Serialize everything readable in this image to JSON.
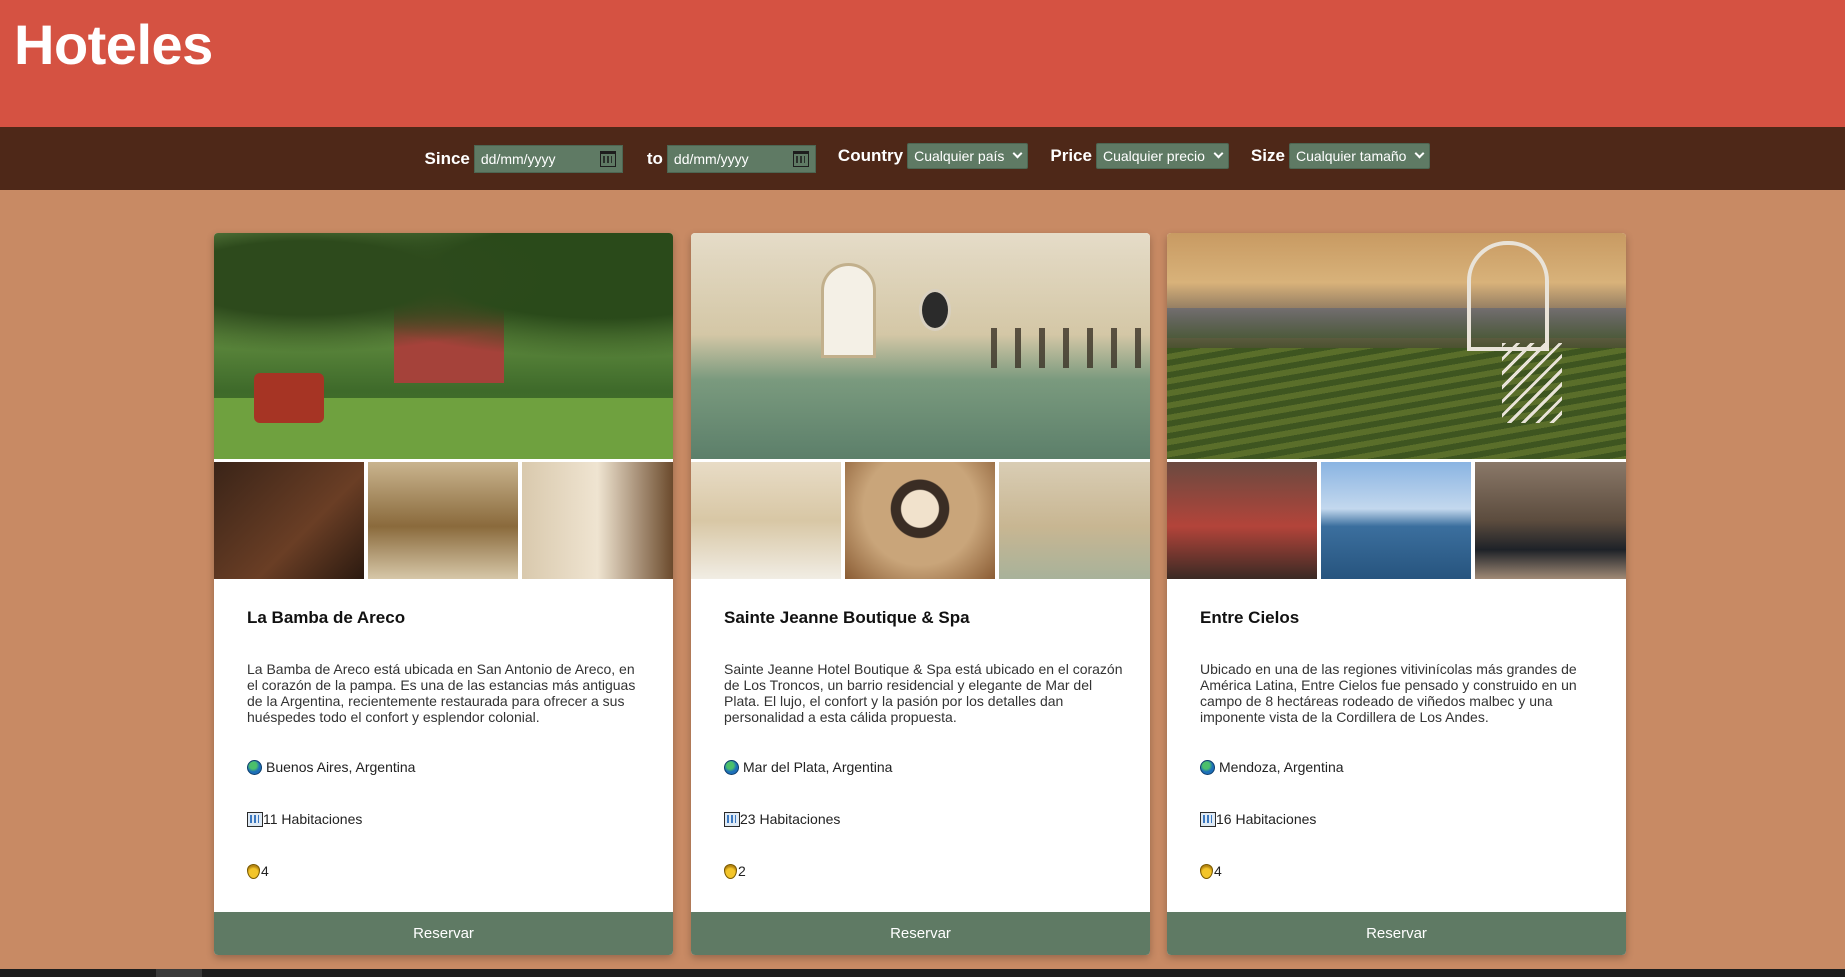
{
  "header": {
    "title": "Hoteles"
  },
  "filters": {
    "since_label": "Since",
    "since_placeholder": "dd/mm/yyyy",
    "to_label": "to",
    "to_placeholder": "dd/mm/yyyy",
    "country_label": "Country",
    "country_value": "Cualquier país",
    "price_label": "Price",
    "price_value": "Cualquier precio",
    "size_label": "Size",
    "size_value": "Cualquier tamaño"
  },
  "hotels": [
    {
      "name": "La Bamba de Areco",
      "description": "La Bamba de Areco está ubicada en San Antonio de Areco, en el corazón de la pampa. Es una de las estancias más antiguas de la Argentina, recientemente restaurada para ofrecer a sus huéspedes todo el confort y esplendor colonial.",
      "location": "Buenos Aires, Argentina",
      "rooms": "11 Habitaciones",
      "price_level": "4",
      "button": "Reservar"
    },
    {
      "name": "Sainte Jeanne Boutique & Spa",
      "description": "Sainte Jeanne Hotel Boutique & Spa está ubicado en el corazón de Los Troncos, un barrio residencial y elegante de Mar del Plata. El lujo, el confort y la pasión por los detalles dan personalidad a esta cálida propuesta.",
      "location": "Mar del Plata, Argentina",
      "rooms": "23 Habitaciones",
      "price_level": "2",
      "button": "Reservar"
    },
    {
      "name": "Entre Cielos",
      "description": "Ubicado en una de las regiones vitivinícolas más grandes de América Latina, Entre Cielos fue pensado y construido en un campo de 8 hectáreas rodeado de viñedos malbec y una imponente vista de la Cordillera de Los Andes.",
      "location": "Mendoza, Argentina",
      "rooms": "16 Habitaciones",
      "price_level": "4",
      "button": "Reservar"
    }
  ],
  "colors": {
    "header_bg": "#d55242",
    "filterbar_bg": "#4e2818",
    "page_bg": "#c88a64",
    "accent_green": "#5f7a64"
  },
  "icons": [
    "calendar-icon",
    "chevron-down-icon",
    "globe-icon",
    "building-icon",
    "medal-icon"
  ]
}
